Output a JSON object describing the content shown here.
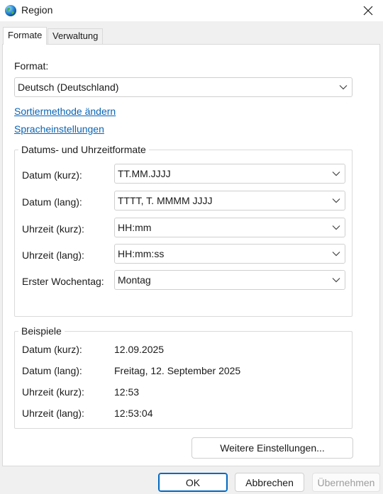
{
  "window": {
    "title": "Region",
    "icon": "globe-icon",
    "close_icon": "close-icon"
  },
  "tabs": [
    {
      "label": "Formate",
      "active": true
    },
    {
      "label": "Verwaltung",
      "active": false
    }
  ],
  "formats": {
    "format_label": "Format:",
    "format_value": "Deutsch (Deutschland)",
    "link_sort": "Sortiermethode ändern",
    "link_language": "Spracheinstellungen",
    "datetime_group": {
      "title": "Datums- und Uhrzeitformate",
      "rows": [
        {
          "label": "Datum (kurz):",
          "value": "TT.MM.JJJJ"
        },
        {
          "label": "Datum (lang):",
          "value": "TTTT, T. MMMM JJJJ"
        },
        {
          "label": "Uhrzeit (kurz):",
          "value": "HH:mm"
        },
        {
          "label": "Uhrzeit (lang):",
          "value": "HH:mm:ss"
        },
        {
          "label": "Erster Wochentag:",
          "value": "Montag"
        }
      ]
    },
    "examples_group": {
      "title": "Beispiele",
      "rows": [
        {
          "label": "Datum (kurz):",
          "value": "12.09.2025"
        },
        {
          "label": "Datum (lang):",
          "value": "Freitag, 12. September 2025"
        },
        {
          "label": "Uhrzeit (kurz):",
          "value": "12:53"
        },
        {
          "label": "Uhrzeit (lang):",
          "value": "12:53:04"
        }
      ]
    },
    "more_settings_label": "Weitere Einstellungen..."
  },
  "buttons": {
    "ok": "OK",
    "cancel": "Abbrechen",
    "apply": "Übernehmen"
  },
  "colors": {
    "link": "#0a64b4",
    "primary_border": "#0067c0"
  }
}
